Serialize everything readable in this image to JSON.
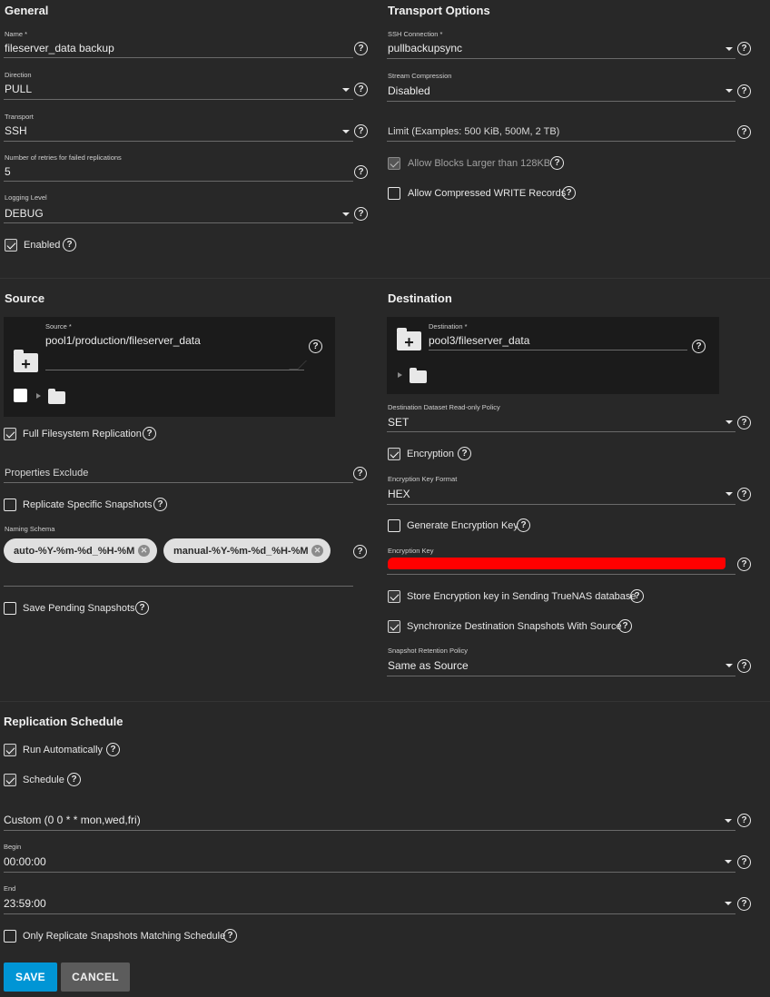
{
  "general": {
    "title": "General",
    "name_label": "Name *",
    "name_value": "fileserver_data backup",
    "direction_label": "Direction",
    "direction_value": "PULL",
    "transport_label": "Transport",
    "transport_value": "SSH",
    "retries_label": "Number of retries for failed replications",
    "retries_value": "5",
    "logging_label": "Logging Level",
    "logging_value": "DEBUG",
    "enabled_label": "Enabled",
    "enabled_checked": true
  },
  "transport_options": {
    "title": "Transport Options",
    "ssh_label": "SSH Connection *",
    "ssh_value": "pullbackupsync",
    "compression_label": "Stream Compression",
    "compression_value": "Disabled",
    "limit_placeholder": "Limit (Examples: 500 KiB, 500M, 2 TB)",
    "large_blocks_label": "Allow Blocks Larger than 128KB",
    "large_blocks_checked": true,
    "compressed_write_label": "Allow Compressed WRITE Records",
    "compressed_write_checked": false
  },
  "source": {
    "title": "Source",
    "source_label": "Source *",
    "source_value": "pool1/production/fileserver_data",
    "full_fs_label": "Full Filesystem Replication",
    "full_fs_checked": true,
    "properties_exclude_placeholder": "Properties Exclude",
    "replicate_specific_label": "Replicate Specific Snapshots",
    "replicate_specific_checked": false,
    "naming_schema_label": "Naming Schema",
    "naming_schema_chips": [
      "auto-%Y-%m-%d_%H-%M",
      "manual-%Y-%m-%d_%H-%M"
    ],
    "save_pending_label": "Save Pending Snapshots",
    "save_pending_checked": false
  },
  "destination": {
    "title": "Destination",
    "destination_label": "Destination *",
    "destination_value": "pool3/fileserver_data",
    "readonly_label": "Destination Dataset Read-only Policy",
    "readonly_value": "SET",
    "encryption_label": "Encryption",
    "encryption_checked": true,
    "key_format_label": "Encryption Key Format",
    "key_format_value": "HEX",
    "generate_key_label": "Generate Encryption Key",
    "generate_key_checked": false,
    "key_label": "Encryption Key",
    "store_key_label": "Store Encryption key in Sending TrueNAS database",
    "store_key_checked": true,
    "sync_label": "Synchronize Destination Snapshots With Source",
    "sync_checked": true,
    "retention_label": "Snapshot Retention Policy",
    "retention_value": "Same as Source"
  },
  "schedule": {
    "title": "Replication Schedule",
    "run_auto_label": "Run Automatically",
    "run_auto_checked": true,
    "schedule_label": "Schedule",
    "schedule_checked": true,
    "cron_value": "Custom (0 0 * * mon,wed,fri)",
    "begin_label": "Begin",
    "begin_value": "00:00:00",
    "end_label": "End",
    "end_value": "23:59:00",
    "only_matching_label": "Only Replicate Snapshots Matching Schedule",
    "only_matching_checked": false
  },
  "actions": {
    "save_label": "SAVE",
    "cancel_label": "CANCEL"
  },
  "colors": {
    "background": "#282828",
    "panel": "#1b1b1b",
    "save_button": "#0095d5",
    "cancel_button": "#5c5c5c",
    "redaction": "#ff0000"
  },
  "icons": {
    "help": "help-circle-icon",
    "dropdown": "caret-down-icon",
    "folder_add": "folder-plus-icon",
    "folder": "folder-icon",
    "chip_remove": "cancel-circle-icon"
  }
}
